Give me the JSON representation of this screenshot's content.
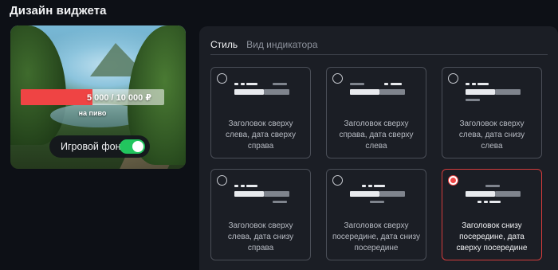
{
  "page": {
    "title": "Дизайн виджета"
  },
  "preview": {
    "progress_text": "5 000 / 10 000 ₽",
    "progress_fraction": 0.5,
    "goal_label": "на пиво",
    "bg_toggle_label": "Игровой фон",
    "bg_toggle_on": true
  },
  "tabs": [
    {
      "label": "Стиль",
      "active": true
    },
    {
      "label": "Вид индикатора",
      "active": false
    }
  ],
  "styles": [
    {
      "caption": "Заголовок сверху слева, дата сверху справа",
      "selected": false
    },
    {
      "caption": "Заголовок сверху справа, дата сверху слева",
      "selected": false
    },
    {
      "caption": "Заголовок сверху слева, дата снизу слева",
      "selected": false
    },
    {
      "caption": "Заголовок сверху слева, дата снизу справа",
      "selected": false
    },
    {
      "caption": "Заголовок сверху посередине, дата снизу посередине",
      "selected": false
    },
    {
      "caption": "Заголовок снизу посередине, дата сверху посередине",
      "selected": true
    }
  ],
  "colors": {
    "accent": "#ef4444",
    "toggle_on": "#22c55e",
    "background": "#0d1016",
    "panel": "#1b1e25"
  }
}
